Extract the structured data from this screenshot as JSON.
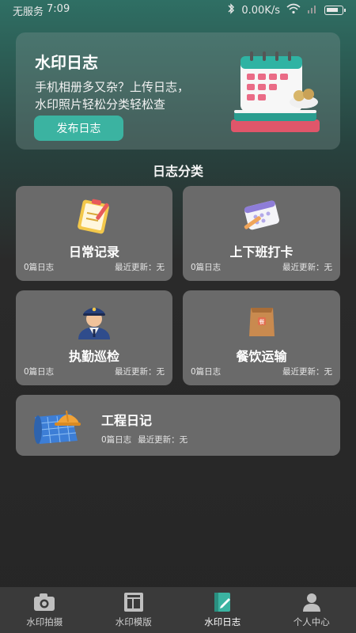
{
  "status": {
    "carrier": "无服务",
    "time": "7:09",
    "speed": "0.00K/s"
  },
  "hero": {
    "title": "水印日志",
    "line1": "手机相册多又杂？上传日志，",
    "line2": "水印照片轻松分类轻松查",
    "button": "发布日志"
  },
  "section_title": "日志分类",
  "cards": [
    {
      "title": "日常记录",
      "count": "0篇日志",
      "update": "最近更新：无",
      "icon": "clipboard-icon"
    },
    {
      "title": "上下班打卡",
      "count": "0篇日志",
      "update": "最近更新：无",
      "icon": "calendar-pen-icon"
    },
    {
      "title": "执勤巡检",
      "count": "0篇日志",
      "update": "最近更新：无",
      "icon": "police-officer-icon"
    },
    {
      "title": "餐饮运输",
      "count": "0篇日志",
      "update": "最近更新：无",
      "icon": "food-package-icon"
    }
  ],
  "wide_card": {
    "title": "工程日记",
    "count": "0篇日志",
    "update": "最近更新：无",
    "icon": "blueprint-helmet-icon"
  },
  "nav": [
    {
      "label": "水印拍摄",
      "icon": "camera-icon"
    },
    {
      "label": "水印模版",
      "icon": "template-icon"
    },
    {
      "label": "水印日志",
      "icon": "log-icon",
      "active": true
    },
    {
      "label": "个人中心",
      "icon": "person-icon"
    }
  ],
  "colors": {
    "accent": "#3bb3a1",
    "card": "#6a6a6a",
    "nav": "#3a3a3a"
  }
}
